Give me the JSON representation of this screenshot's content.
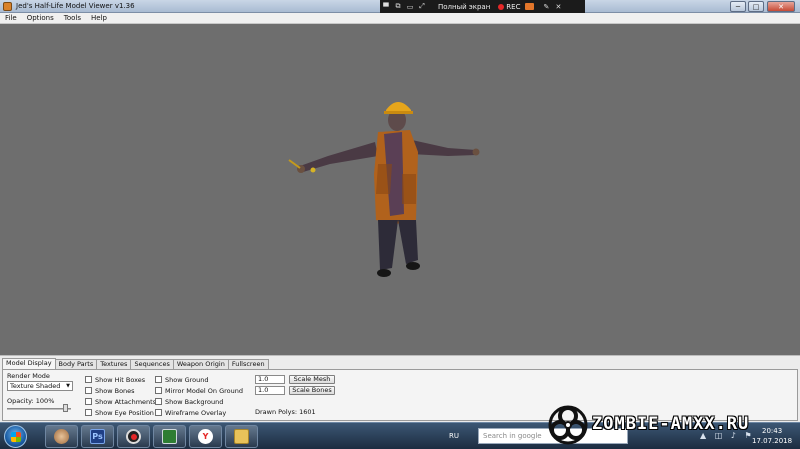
{
  "window": {
    "title": "Jed's Half-Life Model Viewer v1.36",
    "controls": {
      "minimize": "─",
      "maximize": "□",
      "close": "✕"
    }
  },
  "recorder_bar": {
    "fullscreen_label": "Полный экран",
    "rec_label": "REC",
    "icons": [
      "dock-icon",
      "window-icon",
      "fullscreen-icon",
      "pen-icon",
      "close-icon"
    ]
  },
  "menu": [
    "File",
    "Options",
    "Tools",
    "Help"
  ],
  "tabs": [
    "Model Display",
    "Body Parts",
    "Textures",
    "Sequences",
    "Weapon Origin",
    "Fullscreen"
  ],
  "active_tab": "Model Display",
  "model_display": {
    "render_mode_label": "Render Mode",
    "render_mode_value": "Texture Shaded",
    "opacity_label": "Opacity: 100%",
    "opacity_value": 1.0,
    "checkboxes_col1": [
      "Show Hit Boxes",
      "Show Bones",
      "Show Attachments",
      "Show Eye Position"
    ],
    "checkboxes_col2": [
      "Show Ground",
      "Mirror Model On Ground",
      "Show Background",
      "Wireframe Overlay"
    ],
    "scale_mesh_value": "1.0",
    "scale_mesh_button": "Scale Mesh",
    "scale_bones_value": "1.0",
    "scale_bones_button": "Scale Bones",
    "drawn_polys": "Drawn Polys: 1601"
  },
  "taskbar": {
    "language": "RU",
    "search_placeholder": "Search in google",
    "time": "20:43",
    "date": "17.07.2018",
    "apps": [
      {
        "name": "user-app",
        "label": ""
      },
      {
        "name": "photoshop",
        "label": "Ps"
      },
      {
        "name": "recorder",
        "label": ""
      },
      {
        "name": "monitor",
        "label": ""
      },
      {
        "name": "yandex-browser",
        "label": "Y"
      },
      {
        "name": "file-explorer",
        "label": ""
      }
    ]
  },
  "watermark": {
    "text": "ZOMBIE-AMXX.RU"
  },
  "colors": {
    "viewport_bg": "#6e6e6e",
    "panel_bg": "#ececec",
    "taskbar": "#2a3f57",
    "accent_orange": "#c9731c"
  }
}
